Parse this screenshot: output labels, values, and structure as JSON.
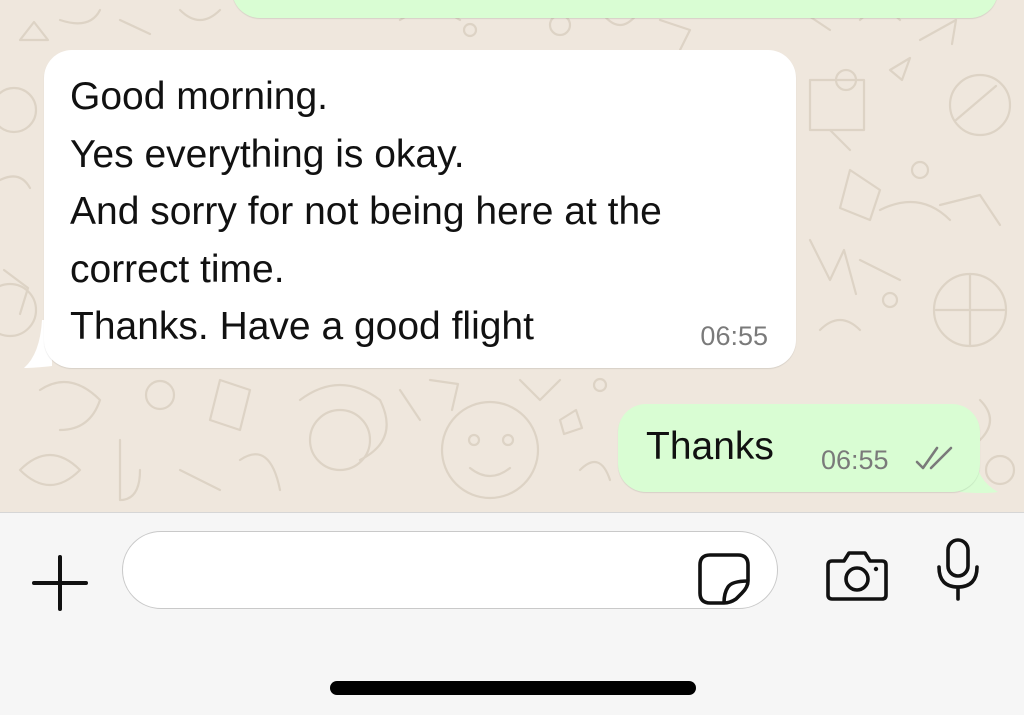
{
  "colors": {
    "wallpaper": "#efe7dd",
    "incoming_bubble": "#ffffff",
    "outgoing_bubble": "#d9fdd3",
    "composer_bar": "#f6f6f6"
  },
  "chat": {
    "messages": [
      {
        "direction": "incoming",
        "lines": [
          "Good morning.",
          "Yes everything is okay.",
          "And sorry for not being here at the",
          "correct time.",
          "Thanks. Have a good flight"
        ],
        "time": "06:55"
      },
      {
        "direction": "outgoing",
        "text": "Thanks",
        "time": "06:55",
        "status_icon": "double-check-icon"
      }
    ]
  },
  "composer": {
    "input_value": "",
    "icons": [
      "plus-icon",
      "sticker-icon",
      "camera-icon",
      "microphone-icon"
    ]
  }
}
